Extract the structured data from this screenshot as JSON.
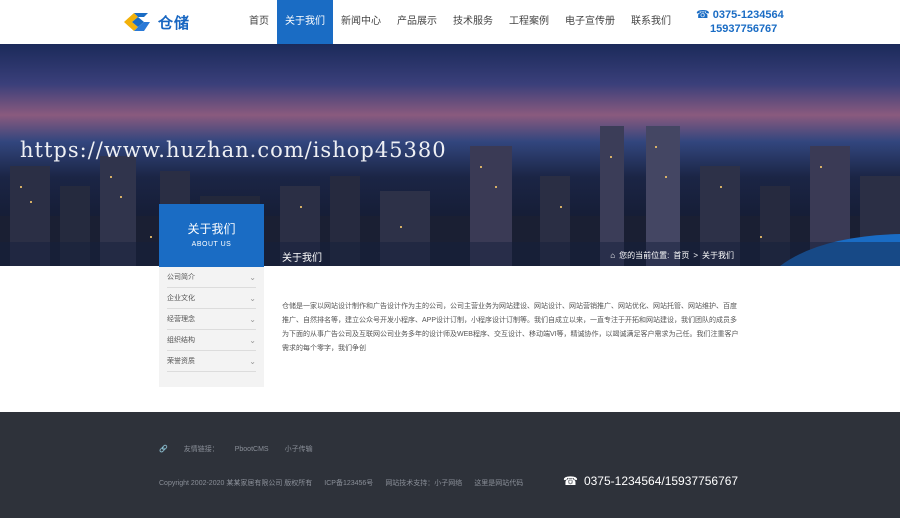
{
  "header": {
    "logo_text": "仓储",
    "nav": [
      "首页",
      "关于我们",
      "新闻中心",
      "产品展示",
      "技术服务",
      "工程案例",
      "电子宣传册",
      "联系我们"
    ],
    "phone1": "0375-1234564",
    "phone2": "15937756767"
  },
  "banner": {
    "watermark": "https://www.huzhan.com/ishop45380",
    "section_title": "关于我们",
    "breadcrumb_prefix": "您的当前位置:",
    "breadcrumb_home": "首页",
    "breadcrumb_current": "关于我们"
  },
  "sidebar": {
    "title": "关于我们",
    "subtitle": "ABOUT US",
    "items": [
      "公司简介",
      "企业文化",
      "经营理念",
      "组织结构",
      "荣誉资质"
    ]
  },
  "content": {
    "paragraph": "仓储是一家以网站设计制作和广告设计作为主的公司，公司主营业务为网站建设、网站设计、网站营销推广、网站优化、网站托管、网站维护、百度推广、自然排名等，建立公众号开发小程序、APP设计订制，小程序设计订制等。我们自成立以来，一直专注于开拓和网站建设，我们团队的成员多为下面的从事广告公司及互联网公司业务多年的设计师及WEB程序、交互设计、移动端VI等，精诚协作，以竭诚满足客户需求为己任。我们注重客户需求的每个零字，我们争创"
  },
  "footer": {
    "links_label": "友情链接：",
    "links": [
      "PbootCMS",
      "小子传输"
    ],
    "copyright": "Copyright 2002-2020 某某家居有限公司 版权所有",
    "icp": "ICP备123456号",
    "support": "网站技术支持：小子网络",
    "sitemap": "这里是网站代码",
    "phone": "0375-1234564/15937756767"
  }
}
